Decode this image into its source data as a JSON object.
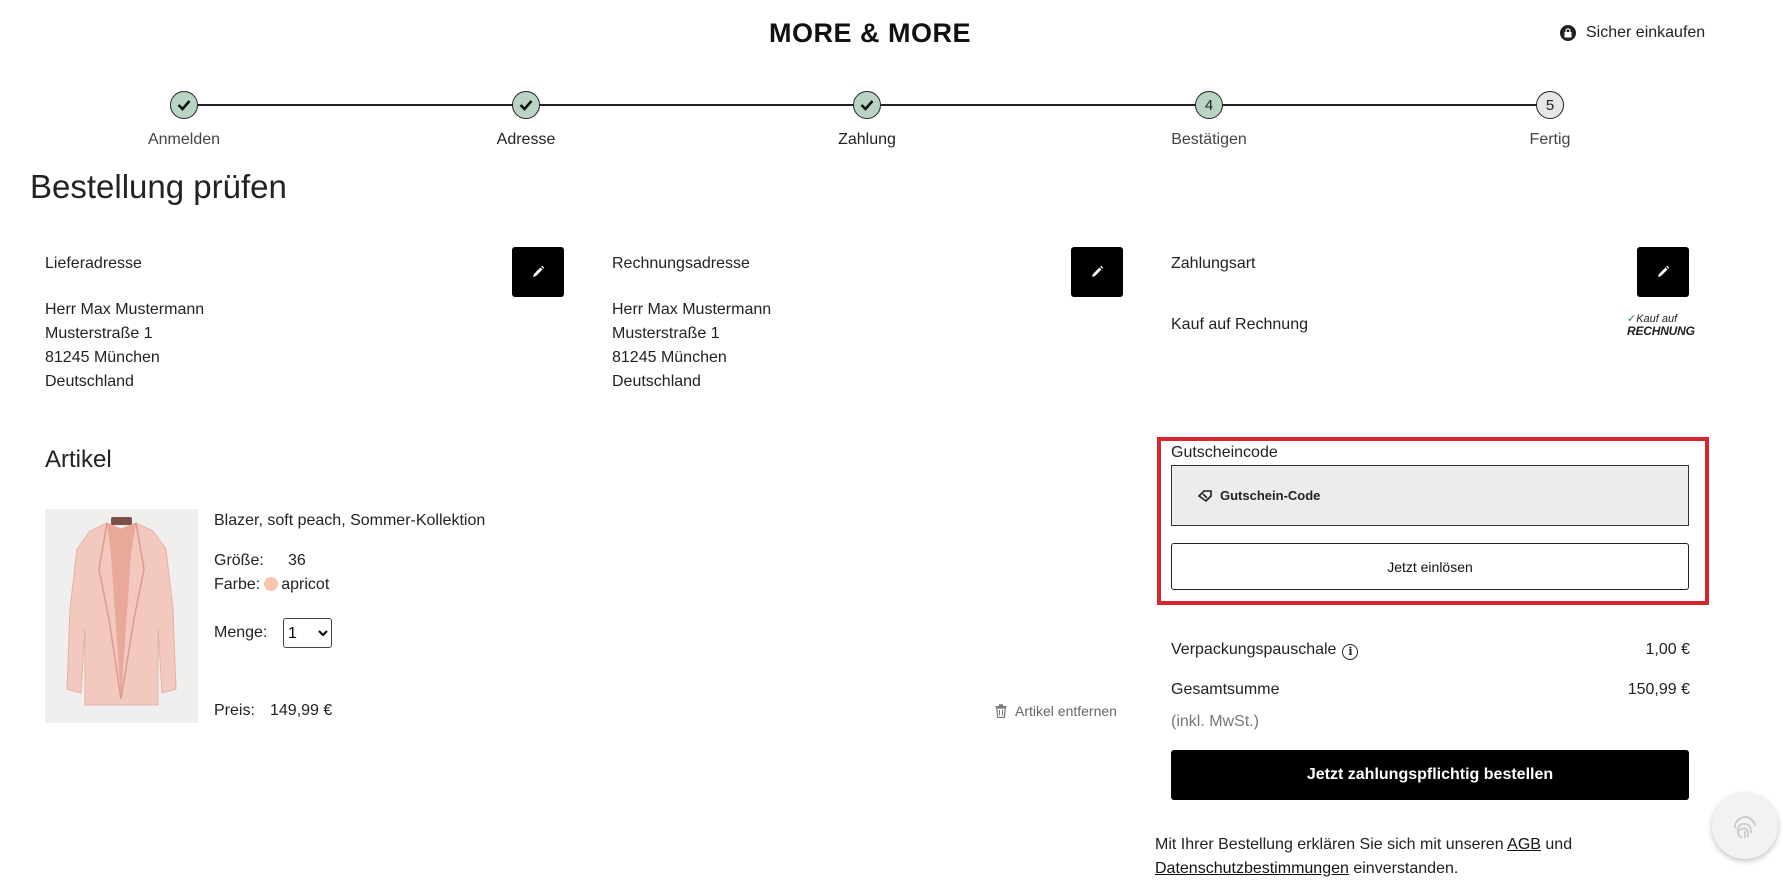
{
  "header": {
    "logo": "MORE & MORE",
    "secure_label": "Sicher einkaufen"
  },
  "stepper": {
    "steps": [
      {
        "label": "Anmelden",
        "state": "done"
      },
      {
        "label": "Adresse",
        "state": "done"
      },
      {
        "label": "Zahlung",
        "state": "done"
      },
      {
        "label": "Bestätigen",
        "number": "4",
        "state": "current"
      },
      {
        "label": "Fertig",
        "number": "5",
        "state": "future"
      }
    ]
  },
  "page": {
    "title": "Bestellung prüfen"
  },
  "shipping": {
    "title": "Lieferadresse",
    "lines": [
      "Herr Max Mustermann",
      "Musterstraße 1",
      "81245 München",
      "Deutschland"
    ]
  },
  "billing": {
    "title": "Rechnungsadresse",
    "lines": [
      "Herr Max Mustermann",
      "Musterstraße 1",
      "81245 München",
      "Deutschland"
    ]
  },
  "payment": {
    "title": "Zahlungsart",
    "method": "Kauf auf Rechnung",
    "logo_line1": "Kauf auf",
    "logo_line2": "RECHNUNG"
  },
  "articles": {
    "title": "Artikel",
    "item": {
      "name": "Blazer, soft peach, Sommer-Kollektion",
      "size_label": "Größe:",
      "size": "36",
      "color_label": "Farbe:",
      "color": "apricot",
      "color_hex": "#f6c6b2",
      "qty_label": "Menge:",
      "qty": "1",
      "price_label": "Preis:",
      "price": "149,99 €",
      "remove_label": "Artikel entfernen"
    }
  },
  "coupon": {
    "label": "Gutscheincode",
    "placeholder": "Gutschein-Code",
    "button": "Jetzt einlösen"
  },
  "summary": {
    "packaging_label": "Verpackungspauschale",
    "packaging_value": "1,00 €",
    "total_label": "Gesamtsumme",
    "total_value": "150,99 €",
    "vat_note": "(inkl. MwSt.)",
    "order_button": "Jetzt zahlungspflichtig bestellen"
  },
  "legal": {
    "prefix": "Mit Ihrer Bestellung erklären Sie sich mit unseren",
    "agb": "AGB",
    "and": "und",
    "privacy": "Datenschutzbestimmungen",
    "suffix": "einverstanden."
  },
  "colors": {
    "accent": "#b9d4c2",
    "highlight": "#d7262f",
    "primary_button": "#000000"
  }
}
